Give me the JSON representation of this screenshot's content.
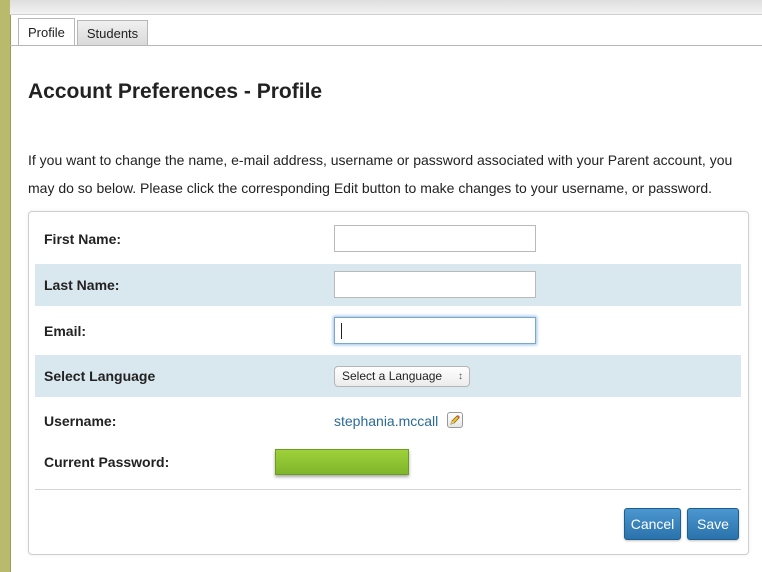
{
  "tabs": [
    {
      "label": "Profile",
      "active": true
    },
    {
      "label": "Students",
      "active": false
    }
  ],
  "page": {
    "title": "Account Preferences - Profile",
    "description": "If you want to change the name, e-mail address, username or password associated with your Parent account, you may do so below. Please click the corresponding Edit button to make changes to your username, or password."
  },
  "form": {
    "first_name_label": "First Name:",
    "first_name_value": "",
    "last_name_label": "Last Name:",
    "last_name_value": "",
    "email_label": "Email:",
    "email_value": "",
    "language_label": "Select Language",
    "language_selected": "Select a Language",
    "username_label": "Username:",
    "username_value": "stephania.mccall",
    "password_label": "Current Password:"
  },
  "buttons": {
    "cancel": "Cancel",
    "save": "Save"
  },
  "icons": {
    "edit": "pencil-edit-icon",
    "select_arrows": "up-down-arrows-icon"
  },
  "colors": {
    "accent_button": "#2f7bb5",
    "row_shade": "#d9e7ee",
    "link": "#2b6a97",
    "password_highlight": "#8fc332",
    "sidebar": "#b9ba6c"
  }
}
